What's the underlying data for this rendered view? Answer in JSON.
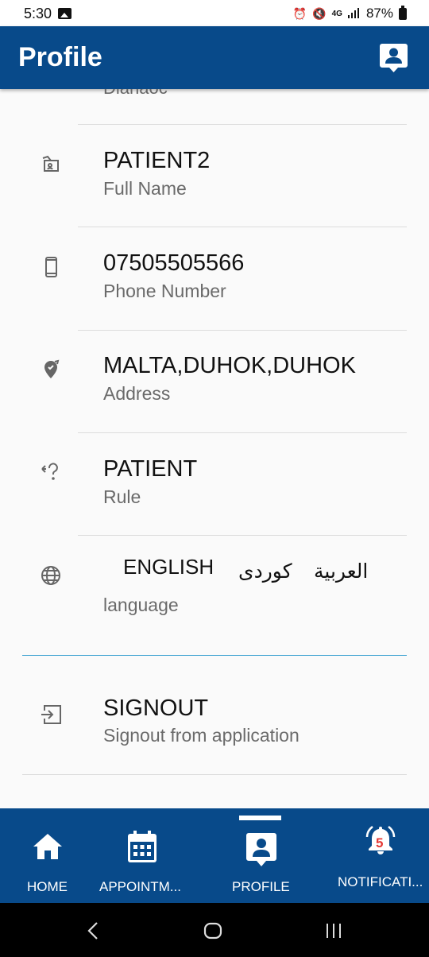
{
  "status_bar": {
    "time": "5:30",
    "network": "4G",
    "battery": "87%"
  },
  "app_bar": {
    "title": "Profile",
    "icon": "account-box-icon"
  },
  "profile": {
    "cut_off_text": "Dlanaoc",
    "rows": [
      {
        "icon": "id-card-icon",
        "value": "PATIENT2",
        "label": "Full Name"
      },
      {
        "icon": "phone-icon",
        "value": "07505505566",
        "label": "Phone Number"
      },
      {
        "icon": "location-icon",
        "value": "MALTA,DUHOK,DUHOK",
        "label": "Address"
      },
      {
        "icon": "help-icon",
        "value": "PATIENT",
        "label": "Rule"
      }
    ],
    "language": {
      "icon": "globe-icon",
      "options": [
        "ENGLISH",
        "كوردى",
        "العربية"
      ],
      "label": "language"
    },
    "signout": {
      "icon": "logout-icon",
      "title": "SIGNOUT",
      "subtitle": "Signout from application"
    }
  },
  "bottom_nav": {
    "items": [
      {
        "label": "HOME",
        "icon": "home-icon"
      },
      {
        "label": "APPOINTM...",
        "icon": "calendar-icon"
      },
      {
        "label": "PROFILE",
        "icon": "profile-icon",
        "active": true
      },
      {
        "label": "NOTIFICATI...",
        "icon": "bell-icon",
        "badge": "5"
      }
    ]
  },
  "colors": {
    "primary": "#084a8a",
    "accent_divider": "#3aa0d0",
    "badge": "#e53935"
  }
}
